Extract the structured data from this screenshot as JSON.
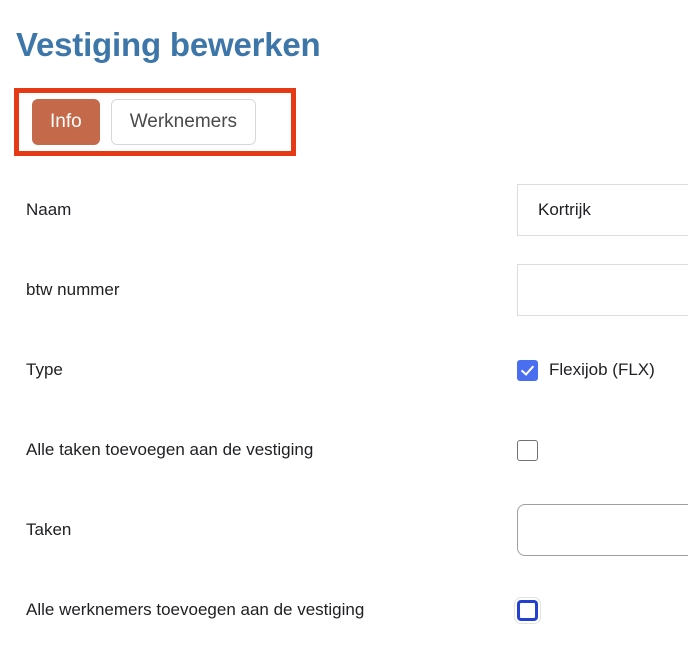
{
  "page": {
    "title": "Vestiging bewerken",
    "title_color": "#3d76a8"
  },
  "highlight": {
    "color": "#e63a17"
  },
  "tabs": {
    "active_index": 0,
    "items": [
      {
        "label": "Info",
        "active": true
      },
      {
        "label": "Werknemers",
        "active": false
      }
    ],
    "active_color": "#c46a4b"
  },
  "form": {
    "rows": [
      {
        "label": "Naam",
        "control": "text",
        "value": "Kortrijk",
        "placeholder": ""
      },
      {
        "label": "btw nummer",
        "control": "text",
        "value": "",
        "placeholder": ""
      },
      {
        "label": "Type",
        "control": "checkbox",
        "checkbox_label": "Flexijob (FLX)",
        "state": "checked",
        "accent": "#4a6ef0"
      },
      {
        "label": "Alle taken toevoegen aan de vestiging",
        "control": "checkbox",
        "checkbox_label": "",
        "state": "unchecked"
      },
      {
        "label": "Taken",
        "control": "text",
        "value": "",
        "placeholder": ""
      },
      {
        "label": "Alle werknemers toevoegen aan de vestiging",
        "control": "checkbox",
        "checkbox_label": "",
        "state": "focused",
        "accent": "#2440cf"
      }
    ]
  }
}
